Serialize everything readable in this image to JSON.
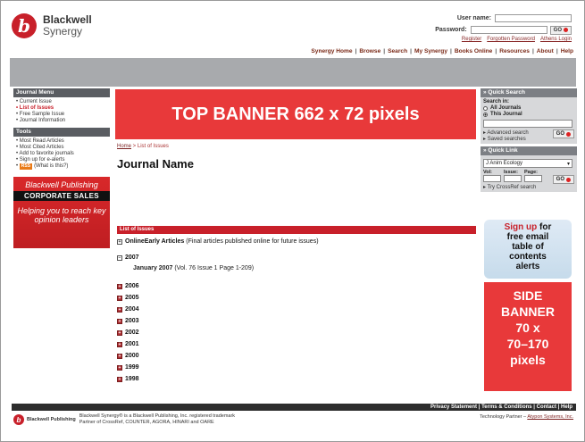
{
  "header": {
    "logo_line1": "Blackwell",
    "logo_line2": "Synergy",
    "login": {
      "username_label": "User name:",
      "password_label": "Password:",
      "go_label": "GO",
      "links": [
        "Register",
        "Forgotten Password",
        "Athens Login"
      ]
    },
    "nav": [
      "Synergy Home",
      "Browse",
      "Search",
      "My Synergy",
      "Books Online",
      "Resources",
      "About",
      "Help"
    ]
  },
  "left": {
    "journal_menu_title": "Journal Menu",
    "journal_menu": [
      "Current Issue",
      "List of Issues",
      "Free Sample Issue",
      "Journal Information"
    ],
    "tools_title": "Tools",
    "tools": [
      "Most Read Articles",
      "Most Cited Articles",
      "Add to favorite journals",
      "Sign up for e-alerts"
    ],
    "rss_label": "RSS",
    "rss_note": "(What is this?)",
    "ad": {
      "line1": "Blackwell Publishing",
      "line2": "CORPORATE SALES",
      "line3": "Helping you to reach key opinion leaders"
    }
  },
  "banners": {
    "top": "TOP BANNER 662 x 72 pixels",
    "side": [
      "SIDE",
      "BANNER",
      "70 x",
      "70–170",
      "pixels"
    ]
  },
  "main": {
    "breadcrumb_home": "Home",
    "breadcrumb_sep": " > ",
    "breadcrumb_current": "List of Issues",
    "journal_name": "Journal Name",
    "issues_title": "List of Issues",
    "online_early": {
      "label": "OnlineEarly Articles",
      "note": "(Final articles published online for future issues)"
    },
    "open_year": "2007",
    "open_issue": {
      "label": "January 2007",
      "note": "(Vol. 76 Issue 1 Page 1-209)"
    },
    "years": [
      "2006",
      "2005",
      "2004",
      "2003",
      "2002",
      "2001",
      "2000",
      "1999",
      "1998"
    ]
  },
  "right": {
    "quick_search_title": "Quick Search",
    "search_in": "Search in:",
    "opt_all": "All Journals",
    "opt_this": "This Journal",
    "advanced": "Advanced search",
    "saved": "Saved searches",
    "go_label": "GO",
    "quick_link_title": "Quick Link",
    "journal_select": "J Anim Ecology",
    "vol_label": "Vol:",
    "issue_label": "Issue:",
    "page_label": "Page:",
    "crossref": "Try CrossRef search",
    "signup": {
      "line1": "Sign up",
      "line1b": " for",
      "line2": "free email",
      "line3": "table of",
      "line4": "contents",
      "line5": "alerts"
    }
  },
  "footer": {
    "links": "Privacy Statement | Terms & Conditions | Contact | Help",
    "brand": "Blackwell Publishing",
    "text1": "Blackwell Synergy® is a Blackwell Publishing, Inc. registered trademark",
    "text2": "Partner of CrossRef, COUNTER, AGORA, HINARI and OARE",
    "partner_label": "Technology Partner – ",
    "partner_link": "Atypon Systems, Inc."
  }
}
